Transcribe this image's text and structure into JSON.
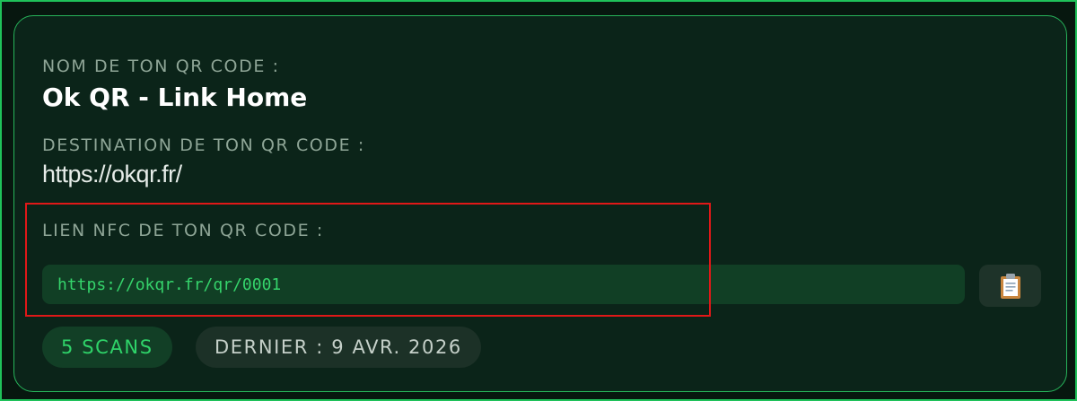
{
  "card": {
    "name_label": "NOM DE TON QR CODE :",
    "name": "Ok QR - Link Home",
    "destination_label": "DESTINATION DE TON QR CODE :",
    "destination_url": "https://okqr.fr/",
    "nfc_label": "LIEN NFC DE TON QR CODE :",
    "nfc_url": "https://okqr.fr/qr/0001",
    "copy_icon": "clipboard-icon",
    "scans_badge": "5 SCANS",
    "last_scan_badge": "DERNIER : 9 AVR. 2026"
  },
  "colors": {
    "accent": "#27b45a",
    "highlight": "#e01818",
    "nfc_text": "#35d36b"
  }
}
